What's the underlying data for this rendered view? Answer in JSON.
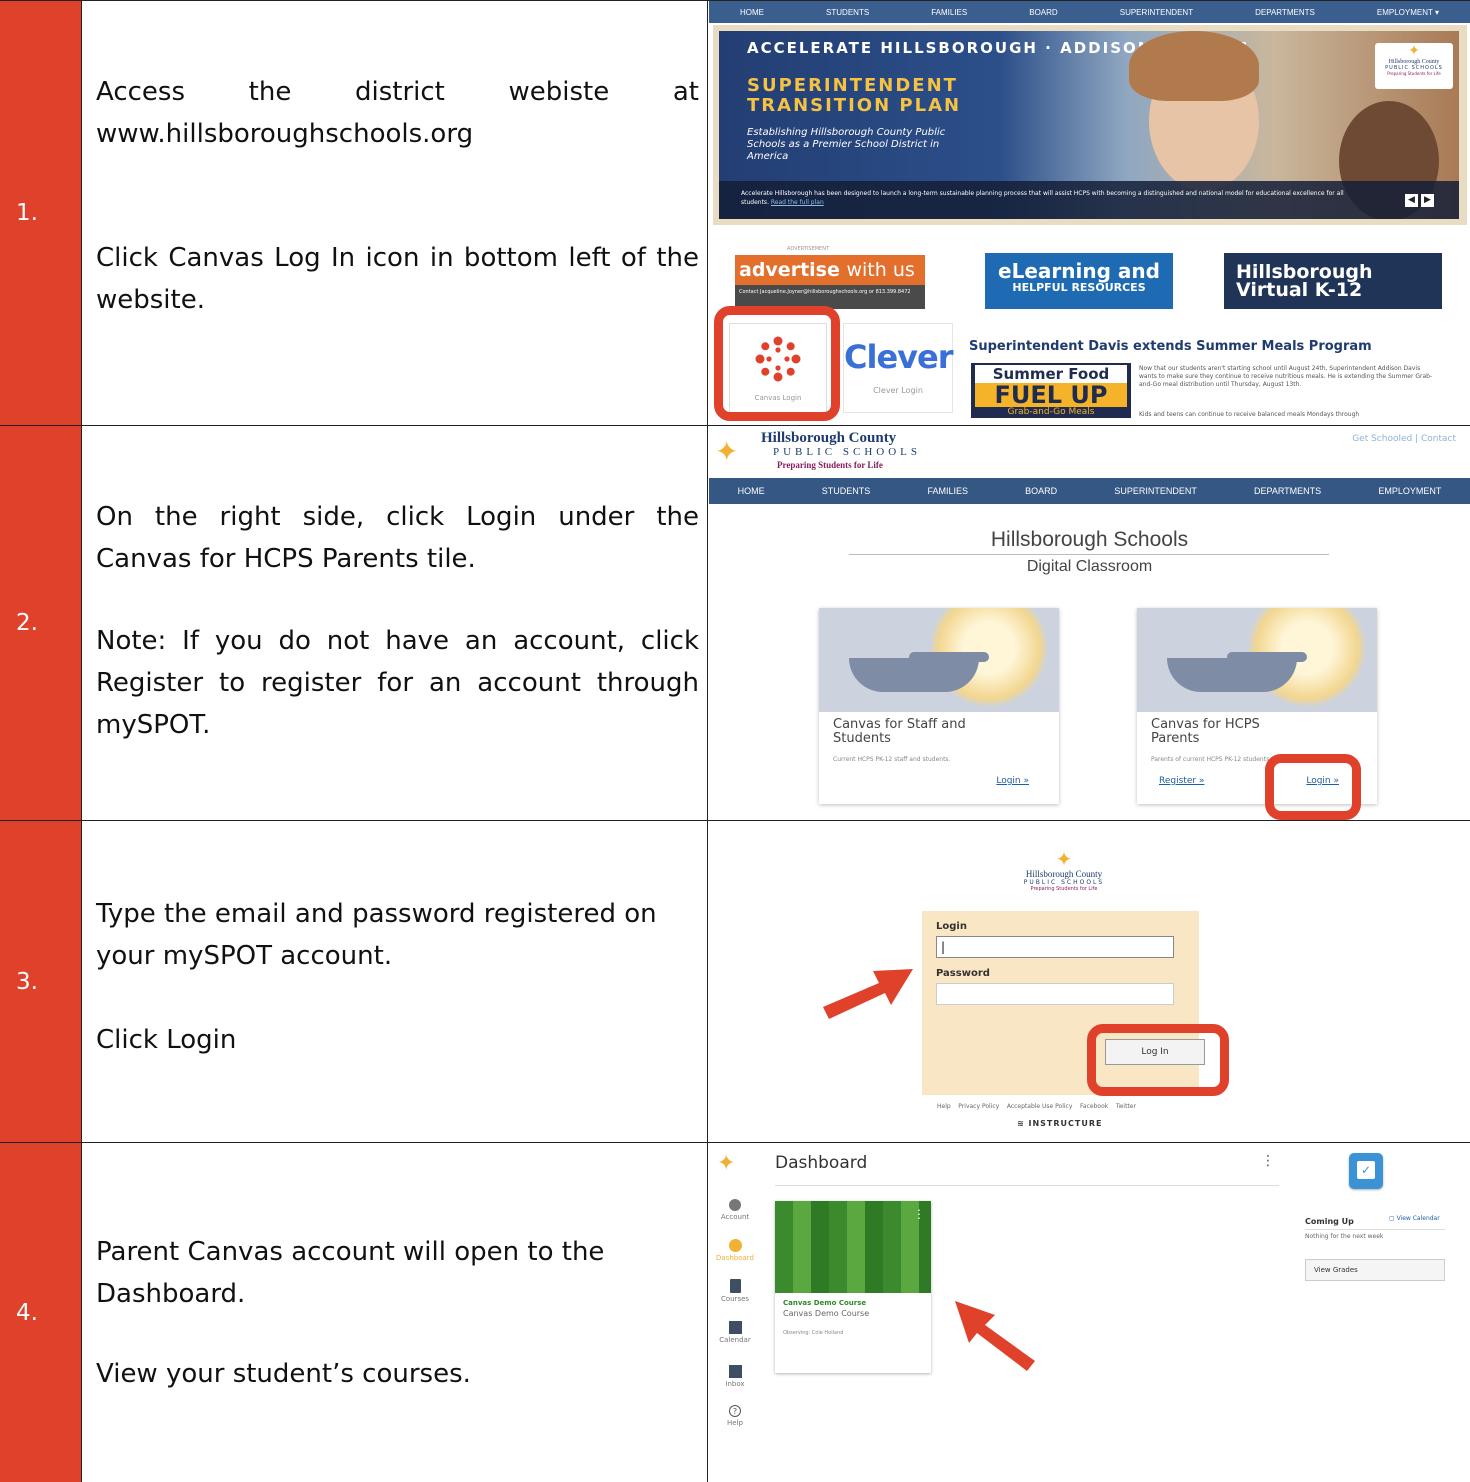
{
  "colors": {
    "accent": "#e0412b",
    "navy": "#345883"
  },
  "steps": [
    {
      "num": "1.",
      "text_a": "Access the district webiste at www.hillsboroughschools.org",
      "text_b": "Click Canvas Log In icon in bottom left of the website."
    },
    {
      "num": "2.",
      "text_a": "On the right side, click Login under the Canvas for HCPS Parents tile.",
      "text_b": "Note: If you do not have an account, click Register to register for an account through mySPOT."
    },
    {
      "num": "3.",
      "text_a": "Type the email and  password registered on your mySPOT account.",
      "text_b": "Click Login"
    },
    {
      "num": "4.",
      "text_a": "Parent Canvas account will open to the Dashboard.",
      "text_b": "View your student’s courses."
    }
  ],
  "site": {
    "nav": [
      "HOME",
      "STUDENTS",
      "FAMILIES",
      "BOARD",
      "SUPERINTENDENT",
      "DEPARTMENTS",
      "EMPLOYMENT ▾"
    ],
    "nav2": [
      "HOME",
      "STUDENTS",
      "FAMILIES",
      "BOARD",
      "SUPERINTENDENT",
      "DEPARTMENTS",
      "EMPLOYMENT"
    ],
    "banner_top": "ACCELERATE HILLSBOROUGH · ADDISON G. DAVIS",
    "banner_title_1": "SUPERINTENDENT",
    "banner_title_2": "TRANSITION PLAN",
    "banner_sub": "Establishing Hillsborough County Public Schools as a Premier School District in America",
    "banner_caption": "Accelerate Hillsborough has been designed to launch a long-term sustainable planning process that will assist HCPS with becoming a distinguished and national model for educational excellence for all students.",
    "banner_readmore": "Read the full plan",
    "logo_name": "Hillsborough County",
    "logo_sub": "PUBLIC SCHOOLS",
    "logo_tag": "Preparing Students for Life",
    "advertisement": "ADVERTISEMENT",
    "advertise_a": "advertise",
    "advertise_b": "with us",
    "advertise_contact": "Contact Jacqueline.Joyner@hillsboroughschools.org or 813.399.8472",
    "elearning_1": "eLearning and",
    "elearning_2": "HELPFUL RESOURCES",
    "virtual_1": "Hillsborough",
    "virtual_2": "Virtual K-12",
    "canvas_label": "Canvas Login",
    "clever_logo": "Clever",
    "clever_label": "Clever Login",
    "news_title": "Superintendent Davis extends Summer Meals Program",
    "summer_1": "Summer Food",
    "summer_2": "FUEL UP",
    "summer_3": "Grab-and-Go Meals",
    "news_body": "Now that our students aren't starting school until August 24th, Superintendent Addison Davis wants to make sure they continue to receive nutritious meals. He is extending the Summer Grab-and-Go meal distribution until Thursday, August 13th.",
    "news_body2": "Kids and teens can continue to receive balanced meals Mondays through"
  },
  "portal": {
    "toplinks": "Get Schooled | Contact",
    "title": "Hillsborough Schools",
    "subtitle": "Digital Classroom",
    "tile1_title": "Canvas for Staff and Students",
    "tile1_desc": "Current HCPS PK-12 staff and students.",
    "tile1_login": "Login »",
    "tile2_title": "Canvas for HCPS Parents",
    "tile2_desc": "Parents of current HCPS PK-12 students.",
    "tile2_register": "Register »",
    "tile2_login": "Login »"
  },
  "login": {
    "login_label": "Login",
    "login_value": "|",
    "password_label": "Password",
    "button": "Log In",
    "footer": "Help    Privacy Policy    Acceptable Use Policy    Facebook    Twitter",
    "brand": "≋ INSTRUCTURE"
  },
  "dashboard": {
    "title": "Dashboard",
    "menu": "⋮",
    "nav": [
      "Account",
      "Dashboard",
      "Courses",
      "Calendar",
      "Inbox",
      "Help"
    ],
    "course_code": "Canvas Demo Course",
    "course_name": "Canvas Demo Course",
    "course_observe": "Observing: Cole Holland",
    "coming_up": "Coming Up",
    "view_calendar": "View Calendar",
    "nothing": "Nothing for the next week",
    "view_grades": "View Grades"
  }
}
